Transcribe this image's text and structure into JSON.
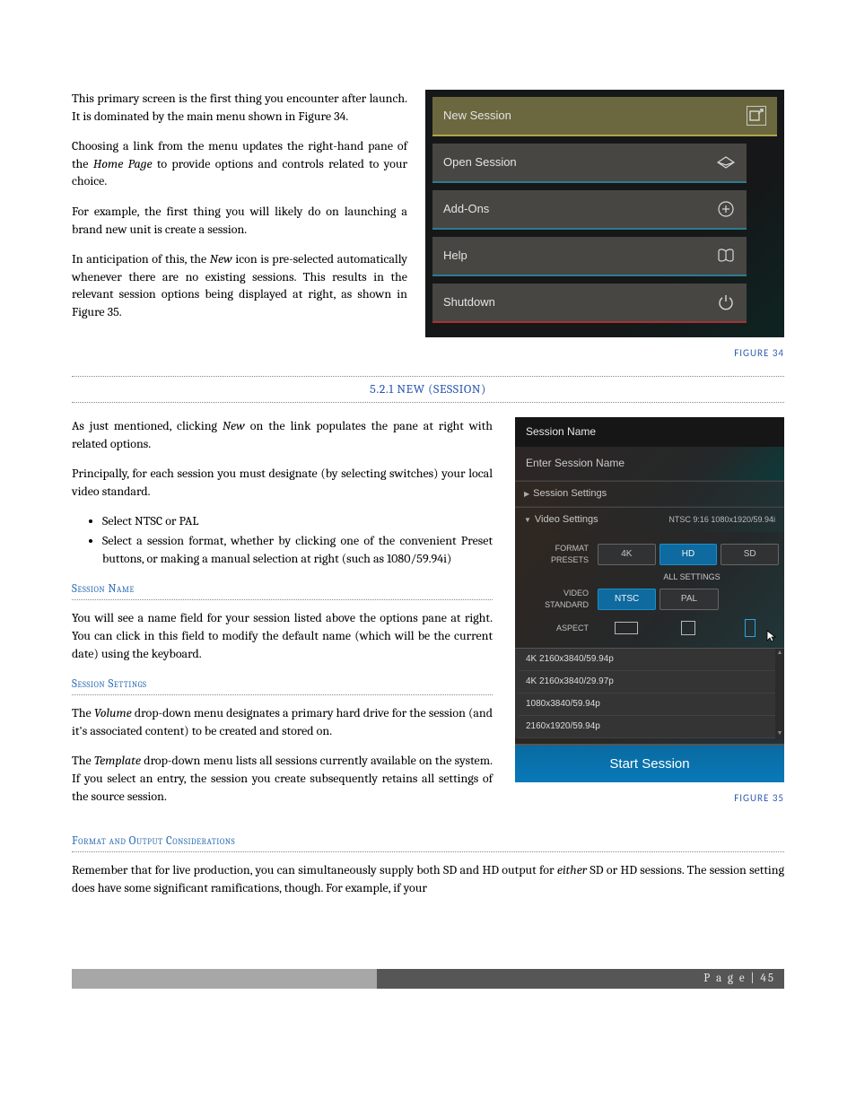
{
  "intro": {
    "p1": "This primary screen is the first thing you encounter after launch.  It is dominated by the main menu shown in Figure 34.",
    "p2a": "Choosing a link from the menu updates the right-hand pane of the ",
    "p2_em": "Home Page",
    "p2b": " to provide options and controls related to your choice.",
    "p3": "For example, the first thing you will likely do on launching a brand new unit is create a session.",
    "p4a": "In anticipation of this, the ",
    "p4_em": "New",
    "p4b": " icon is pre-selected automatically whenever there are no existing sessions.  This results in the relevant session options being displayed at right, as shown in Figure 35."
  },
  "menu": {
    "items": [
      {
        "label": "New Session"
      },
      {
        "label": "Open Session"
      },
      {
        "label": "Add-Ons"
      },
      {
        "label": "Help"
      },
      {
        "label": "Shutdown"
      }
    ]
  },
  "fig34": "FIGURE 34",
  "heading521": "5.2.1 NEW (SESSION)",
  "sess_intro": {
    "p1a": "As just mentioned, clicking ",
    "p1_em": "New",
    "p1b": " on the link populates the pane at right with related options.",
    "p2": "Principally, for each session you must designate (by selecting switches) your local video standard.",
    "li1": "Select NTSC or PAL",
    "li2": "Select a session format, whether by clicking one of the convenient Preset buttons, or making a manual selection at right (such as 1080/59.94i)"
  },
  "sub_session_name": "Session Name",
  "session_name_text": "You will see a name field for your session listed above the options pane at right.  You can click in this field to modify the default name (which will be the current date) using the keyboard.",
  "sub_session_settings": "Session Settings",
  "session_settings": {
    "p1a": "The ",
    "p1_em": "Volume",
    "p1b": " drop-down menu designates a primary hard drive for the session (and it's associated content) to be created and stored on.",
    "p2a": "The ",
    "p2_em": "Template",
    "p2b": " drop-down menu lists all sessions currently available on the system. If you select an entry, the session you create subsequently retains all settings of the source session."
  },
  "sub_format": "Format and Output Considerations",
  "format_a": "Remember that for live production, you can simultaneously supply both SD and HD output for ",
  "format_em": "either",
  "format_b": " SD or HD sessions. The session setting does have some significant ramifications, though. For example, if your",
  "panel": {
    "header": "Session Name",
    "placeholder": "Enter Session Name",
    "section_settings": "Session Settings",
    "section_video": "Video Settings",
    "video_detail": "NTSC 9:16 1080x1920/59.94i",
    "label_presets": "FORMAT PRESETS",
    "presets": {
      "k4": "4K",
      "hd": "HD",
      "sd": "SD"
    },
    "all_settings": "ALL SETTINGS",
    "label_standard": "VIDEO STANDARD",
    "standards": {
      "ntsc": "NTSC",
      "pal": "PAL"
    },
    "label_aspect": "ASPECT",
    "formats": [
      "4K 2160x3840/59.94p",
      "4K 2160x3840/29.97p",
      "1080x3840/59.94p",
      "2160x1920/59.94p"
    ],
    "start": "Start Session"
  },
  "fig35": "FIGURE 35",
  "footer": "P a g e  | 45"
}
